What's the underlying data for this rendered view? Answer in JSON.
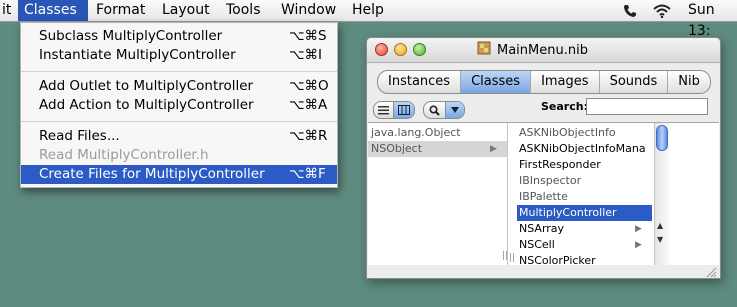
{
  "menubar": {
    "items": [
      "it",
      "Classes",
      "Format",
      "Layout",
      "Tools",
      "Window",
      "Help"
    ],
    "active": "Classes",
    "status_icons": [
      "phone-icon",
      "wifi-icon"
    ],
    "clock": "Sun 13:"
  },
  "classes_menu": {
    "items": [
      {
        "label": "Subclass MultiplyController",
        "shortcut": "⌥⌘S",
        "enabled": true
      },
      {
        "label": "Instantiate MultiplyController",
        "shortcut": "⌥⌘I",
        "enabled": true
      },
      {
        "label": "Add Outlet to MultiplyController",
        "shortcut": "⌥⌘O",
        "enabled": true
      },
      {
        "label": "Add Action to MultiplyController",
        "shortcut": "⌥⌘A",
        "enabled": true
      },
      {
        "label": "Read Files...",
        "shortcut": "⌥⌘R",
        "enabled": true
      },
      {
        "label": "Read MultiplyController.h",
        "shortcut": "",
        "enabled": false
      },
      {
        "label": "Create Files for MultiplyController",
        "shortcut": "⌥⌘F",
        "enabled": true,
        "highlighted": true
      }
    ]
  },
  "window": {
    "title": "MainMenu.nib",
    "tabs": [
      "Instances",
      "Classes",
      "Images",
      "Sounds",
      "Nib"
    ],
    "active_tab": "Classes",
    "search_label": "Search:",
    "search_value": "",
    "column1": [
      "java.lang.Object",
      "NSObject"
    ],
    "column1_selected": "NSObject",
    "column2": [
      {
        "label": "ASKNibObjectInfo",
        "gray": true,
        "arrow": false
      },
      {
        "label": "ASKNibObjectInfoMana",
        "gray": false,
        "arrow": false
      },
      {
        "label": "FirstResponder",
        "gray": false,
        "arrow": false
      },
      {
        "label": "IBInspector",
        "gray": true,
        "arrow": false
      },
      {
        "label": "IBPalette",
        "gray": true,
        "arrow": false
      },
      {
        "label": "MultiplyController",
        "gray": false,
        "arrow": false,
        "selected": true
      },
      {
        "label": "NSArray",
        "gray": false,
        "arrow": true
      },
      {
        "label": "NSCell",
        "gray": false,
        "arrow": true
      },
      {
        "label": "NSColorPicker",
        "gray": false,
        "arrow": false
      }
    ]
  },
  "colors": {
    "desktop": "#5e8b7f",
    "selection": "#2c5bc6",
    "menu_active": "#2a56b8"
  }
}
